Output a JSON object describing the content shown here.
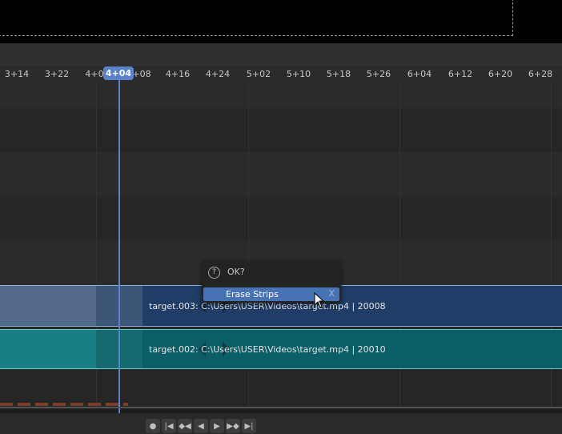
{
  "ruler": {
    "ticks": [
      "3+14",
      "3+22",
      "4+0",
      "+08",
      "4+16",
      "4+24",
      "5+02",
      "5+10",
      "5+18",
      "5+26",
      "6+04",
      "6+12",
      "6+20",
      "6+28"
    ],
    "current_frame": "4+04"
  },
  "strips": [
    {
      "label": "target.003: C:\\Users\\USER\\Videos\\target.mp4 | 20008",
      "color": "#1f3d66"
    },
    {
      "label": "target.002: C:\\Users\\USER\\Videos\\target.mp4 | 20010",
      "color": "#0b5d66"
    }
  ],
  "popup": {
    "title": "OK?",
    "item_label": "Erase Strips",
    "item_shortcut": "X"
  },
  "transport": {
    "icons": [
      "record-icon",
      "jump-start-icon",
      "prev-keyframe-icon",
      "play-reverse-icon",
      "play-icon",
      "next-keyframe-icon",
      "jump-end-icon"
    ]
  },
  "colors": {
    "accent": "#5b82c9",
    "menu_highlight": "#4772b3"
  }
}
